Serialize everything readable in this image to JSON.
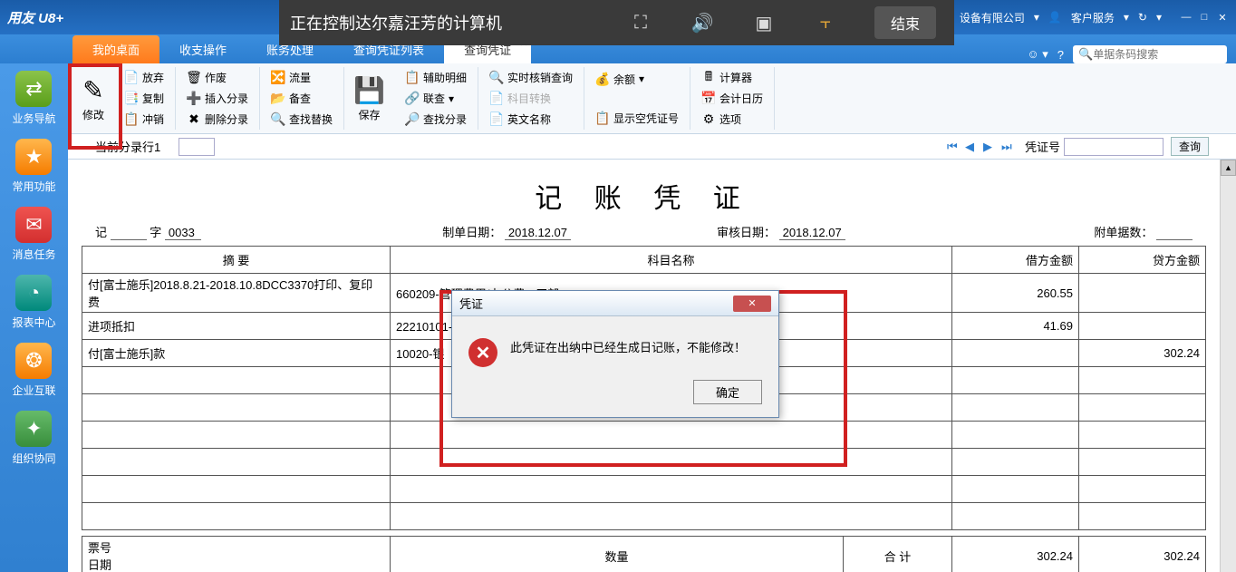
{
  "remote": {
    "text": "正在控制达尔嘉汪芳的计算机",
    "end": "结束"
  },
  "titlebar": {
    "logo": "用友 U8+",
    "company": "1](defsu…)达尔嘉（……）设备有限公司",
    "service": "客户服务"
  },
  "tabs": {
    "items": [
      "我的桌面",
      "收支操作",
      "账务处理",
      "查询凭证列表",
      "查询凭证"
    ],
    "search_placeholder": "单据条码搜索"
  },
  "sidebar": {
    "items": [
      {
        "label": "业务导航"
      },
      {
        "label": "常用功能"
      },
      {
        "label": "消息任务"
      },
      {
        "label": "报表中心"
      },
      {
        "label": "企业互联"
      },
      {
        "label": "组织协同"
      }
    ]
  },
  "ribbon": {
    "modify": "修改",
    "discard": "放弃",
    "void": "作废",
    "flow": "流量",
    "save": "保存",
    "copy": "复制",
    "insert": "插入分录",
    "review": "备查",
    "offset": "冲销",
    "delete": "删除分录",
    "find_replace": "查找替换",
    "aux": "辅助明细",
    "realtime": "实时核销查询",
    "balance": "余额",
    "contact": "联查",
    "subject_conv": "科目转换",
    "find_entry": "查找分录",
    "english": "英文名称",
    "show_empty": "显示空凭证号",
    "calculator": "计算器",
    "calendar": "会计日历",
    "options": "选项"
  },
  "subbar": {
    "current_row": "当前分录行1",
    "voucher_no_label": "凭证号",
    "query": "查询"
  },
  "voucher": {
    "title": "记 账 凭 证",
    "prefix": "记",
    "word": "字",
    "number": "0033",
    "make_date_label": "制单日期：",
    "make_date": "2018.12.07",
    "audit_date_label": "审核日期：",
    "audit_date": "2018.12.07",
    "attach_label": "附单据数：",
    "headers": {
      "summary": "摘 要",
      "subject": "科目名称",
      "debit": "借方金额",
      "credit": "贷方金额"
    },
    "rows": [
      {
        "summary": "付[富士施乐]2018.8.21-2018.10.8DCC3370打印、复印费",
        "subject": "660209-管理费用/办公费 - 厂部",
        "debit": "260.55",
        "credit": ""
      },
      {
        "summary": "进项抵扣",
        "subject": "22210101-应交税费/应交增值税/进项税额",
        "debit": "41.69",
        "credit": ""
      },
      {
        "summary": "付[富士施乐]款",
        "subject": "10020-银",
        "debit": "",
        "credit": "302.24"
      }
    ],
    "footer": {
      "piao": "票号",
      "date": "日期",
      "qty": "数量",
      "total": "合 计",
      "debit_total": "302.24",
      "credit_total": "302.24"
    }
  },
  "dialog": {
    "title": "凭证",
    "message": "此凭证在出纳中已经生成日记账，不能修改！",
    "ok": "确定"
  }
}
